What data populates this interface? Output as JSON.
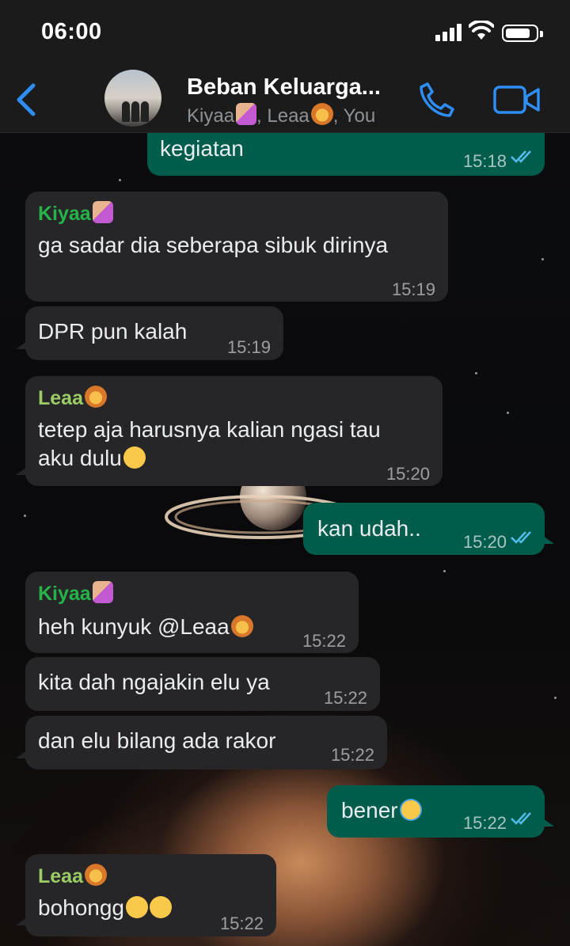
{
  "status": {
    "time": "06:00"
  },
  "header": {
    "title": "Beban Keluarga...",
    "members_a": "Kiyaa",
    "members_b": ", Leaa",
    "members_c": ", You"
  },
  "colors": {
    "outgoing": "#005c4b",
    "incoming": "#262628",
    "accent": "#2e8ef5",
    "kiyaa": "#25b34a",
    "leaa": "#9ccc65"
  },
  "messages": [
    {
      "dir": "out",
      "text": "kegiatan",
      "time": "15:18"
    },
    {
      "dir": "in",
      "sender": "Kiyaa",
      "text": "ga sadar dia seberapa sibuk dirinya",
      "time": "15:19"
    },
    {
      "dir": "in",
      "text": "DPR pun kalah",
      "time": "15:19"
    },
    {
      "dir": "in",
      "sender": "Leaa",
      "text_line1": "tetep aja harusnya kalian ngasi tau",
      "text_line2": "aku dulu",
      "time": "15:20"
    },
    {
      "dir": "out",
      "text": "kan udah..",
      "time": "15:20"
    },
    {
      "dir": "in",
      "sender": "Kiyaa",
      "text": "heh kunyuk @Leaa",
      "time": "15:22"
    },
    {
      "dir": "in",
      "text": "kita dah ngajakin elu ya",
      "time": "15:22"
    },
    {
      "dir": "in",
      "text": "dan elu bilang ada rakor",
      "time": "15:22"
    },
    {
      "dir": "out",
      "text": "bener",
      "time": "15:22"
    },
    {
      "dir": "in",
      "sender": "Leaa",
      "text": "bohongg",
      "time": "15:22"
    }
  ]
}
